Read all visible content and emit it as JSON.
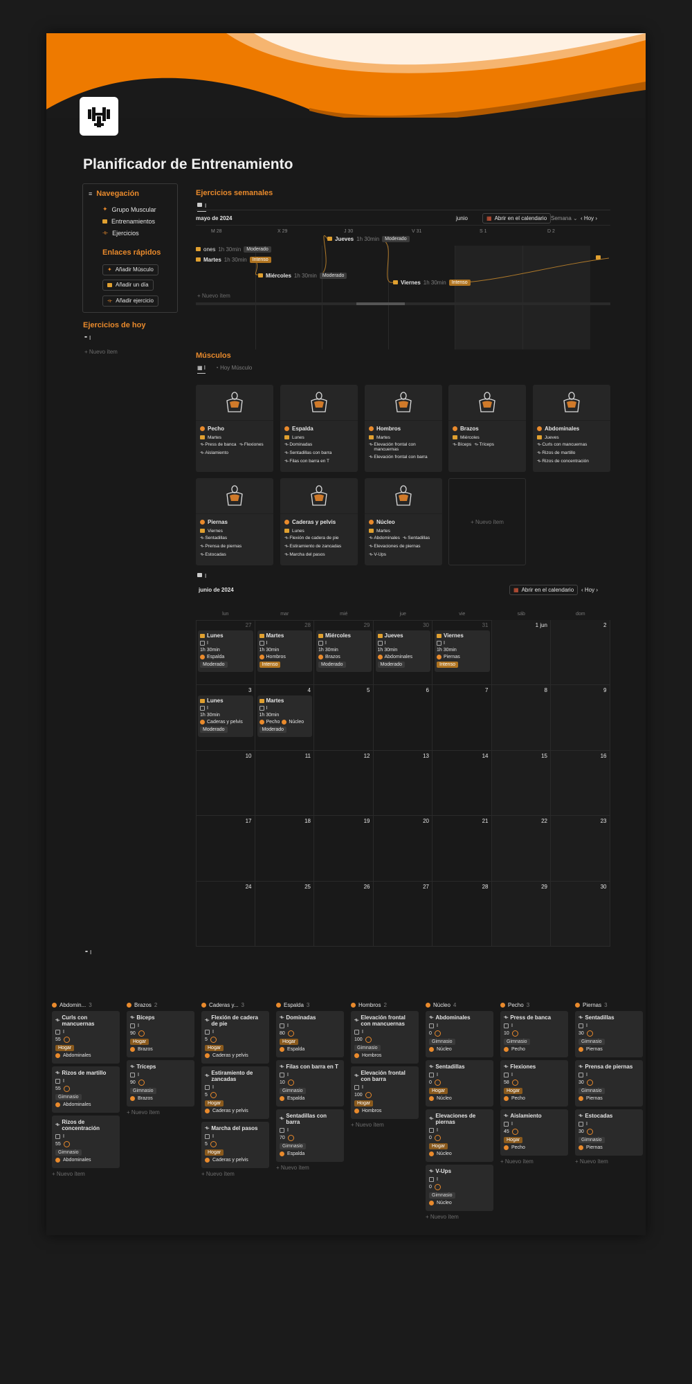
{
  "page": {
    "title": "Planificador de Entrenamiento",
    "colors": {
      "accent": "#e98a2c",
      "background": "#191919",
      "card": "#262626"
    }
  },
  "nav": {
    "heading": "Navegación",
    "items": [
      "Grupo Muscular",
      "Entrenamientos",
      "Ejercicios"
    ],
    "quick_heading": "Enlaces rápidos",
    "quick": [
      "Añadir Músculo",
      "Añadir un día",
      "Añadir ejercicio"
    ]
  },
  "today": {
    "heading": "Ejercicios de hoy",
    "view": "I",
    "new": "+ Nuevo ítem"
  },
  "weekly": {
    "heading": "Ejercicios semanales",
    "view": "I",
    "month": "mayo de 2024",
    "month2": "junio",
    "open_cal": "Abrir en el calendario",
    "scale": "Semana",
    "today": "Hoy",
    "days": [
      "M 28",
      "X 29",
      "J 30",
      "V 31",
      "S 1",
      "D 2"
    ],
    "items": [
      {
        "name": "ones",
        "dur": "1h 30min",
        "tag": "Moderado"
      },
      {
        "name": "Martes",
        "dur": "1h 30min",
        "tag": "Intenso"
      },
      {
        "name": "Jueves",
        "dur": "1h 30min",
        "tag": "Moderado"
      },
      {
        "name": "Miércoles",
        "dur": "1h 30min",
        "tag": "Moderado"
      },
      {
        "name": "Viernes",
        "dur": "1h 30min",
        "tag": "Intenso"
      }
    ],
    "new": "+ Nuevo ítem"
  },
  "muscles": {
    "heading": "Músculos",
    "views": [
      "I",
      "Hoy Músculo"
    ],
    "cards": [
      {
        "name": "Pecho",
        "day": "Martes",
        "ex": [
          "Press de banca",
          "Flexiones",
          "Aislamiento"
        ]
      },
      {
        "name": "Espalda",
        "day": "Lunes",
        "ex": [
          "Dominadas",
          "Sentadillas con barra",
          "Filas con barra en T"
        ]
      },
      {
        "name": "Hombros",
        "day": "Martes",
        "ex": [
          "Elevación frontal con mancuernas",
          "Elevación frontal con barra"
        ]
      },
      {
        "name": "Brazos",
        "day": "Miércoles",
        "ex": [
          "Bíceps",
          "Tríceps"
        ]
      },
      {
        "name": "Abdominales",
        "day": "Jueves",
        "ex": [
          "Curls con mancuernas",
          "Rizos de martillo",
          "Rizos de concentración"
        ]
      },
      {
        "name": "Piernas",
        "day": "Viernes",
        "ex": [
          "Sentadillas",
          "Prensa de piernas",
          "Estocadas"
        ]
      },
      {
        "name": "Caderas y pelvis",
        "day": "Lunes",
        "ex": [
          "Flexión de cadera de pie",
          "Estiramiento de zancadas",
          "Marcha del pasos"
        ]
      },
      {
        "name": "Núcleo",
        "day": "Martes",
        "ex": [
          "Abdominales",
          "Sentadillas",
          "Elevaciones de piernas",
          "V-Ups"
        ]
      }
    ],
    "new": "+ Nuevo ítem"
  },
  "calendar": {
    "view": "I",
    "month": "junio de 2024",
    "open_cal": "Abrir en el calendario",
    "today": "Hoy",
    "weekdays": [
      "lun",
      "mar",
      "mié",
      "jue",
      "vie",
      "sáb",
      "dom"
    ],
    "weeks": [
      [
        "27",
        "28",
        "29",
        "30",
        "31",
        "1 jun",
        "2"
      ],
      [
        "3",
        "4",
        "5",
        "6",
        "7",
        "8",
        "9"
      ],
      [
        "10",
        "11",
        "12",
        "13",
        "14",
        "15",
        "16"
      ],
      [
        "17",
        "18",
        "19",
        "20",
        "21",
        "22",
        "23"
      ],
      [
        "24",
        "25",
        "26",
        "27",
        "28",
        "29",
        "30"
      ]
    ],
    "events": [
      {
        "week": 0,
        "day": 0,
        "name": "Lunes",
        "check": "I",
        "dur": "1h 30min",
        "muscles": [
          "Espalda"
        ],
        "tag": "Moderado"
      },
      {
        "week": 0,
        "day": 1,
        "name": "Martes",
        "check": "I",
        "dur": "1h 30min",
        "muscles": [
          "Hombros"
        ],
        "tag": "Intenso"
      },
      {
        "week": 0,
        "day": 2,
        "name": "Miércoles",
        "check": "I",
        "dur": "1h 30min",
        "muscles": [
          "Brazos"
        ],
        "tag": "Moderado"
      },
      {
        "week": 0,
        "day": 3,
        "name": "Jueves",
        "check": "I",
        "dur": "1h 30min",
        "muscles": [
          "Abdominales"
        ],
        "tag": "Moderado"
      },
      {
        "week": 0,
        "day": 4,
        "name": "Viernes",
        "check": "I",
        "dur": "1h 30min",
        "muscles": [
          "Piernas"
        ],
        "tag": "Intenso"
      },
      {
        "week": 1,
        "day": 0,
        "name": "Lunes",
        "check": "I",
        "dur": "1h 30min",
        "muscles": [
          "Caderas y pelvis"
        ],
        "tag": "Moderado"
      },
      {
        "week": 1,
        "day": 1,
        "name": "Martes",
        "check": "I",
        "dur": "1h 30min",
        "muscles": [
          "Pecho",
          "Núcleo"
        ],
        "tag": "Moderado"
      }
    ]
  },
  "board": {
    "view": "I",
    "new": "+ Nuevo ítem",
    "columns": [
      {
        "name": "Abdomin...",
        "count": "3",
        "cards": [
          {
            "name": "Curls con mancuernas",
            "check": "I",
            "val": "55",
            "place": "Hogar",
            "muscle": "Abdominales"
          },
          {
            "name": "Rizos de martillo",
            "check": "I",
            "val": "55",
            "place": "Gimnasio",
            "muscle": "Abdominales"
          },
          {
            "name": "Rizos de concentración",
            "check": "I",
            "val": "55",
            "place": "Gimnasio",
            "muscle": "Abdominales"
          }
        ]
      },
      {
        "name": "Brazos",
        "count": "2",
        "cards": [
          {
            "name": "Bíceps",
            "check": "I",
            "val": "90",
            "place": "Hogar",
            "muscle": "Brazos"
          },
          {
            "name": "Tríceps",
            "check": "I",
            "val": "90",
            "place": "Gimnasio",
            "muscle": "Brazos"
          }
        ]
      },
      {
        "name": "Caderas y...",
        "count": "3",
        "cards": [
          {
            "name": "Flexión de cadera de pie",
            "check": "I",
            "val": "5",
            "place": "Hogar",
            "muscle": "Caderas y pelvis"
          },
          {
            "name": "Estiramiento de zancadas",
            "check": "I",
            "val": "5",
            "place": "Hogar",
            "muscle": "Caderas y pelvis"
          },
          {
            "name": "Marcha del pasos",
            "check": "I",
            "val": "5",
            "place": "Hogar",
            "muscle": "Caderas y pelvis"
          }
        ]
      },
      {
        "name": "Espalda",
        "count": "3",
        "cards": [
          {
            "name": "Dominadas",
            "check": "I",
            "val": "80",
            "place": "Hogar",
            "muscle": "Espalda"
          },
          {
            "name": "Filas con barra en T",
            "check": "I",
            "val": "10",
            "place": "Gimnasio",
            "muscle": "Espalda"
          },
          {
            "name": "Sentadillas con barra",
            "check": "I",
            "val": "70",
            "place": "Gimnasio",
            "muscle": "Espalda"
          }
        ]
      },
      {
        "name": "Hombros",
        "count": "2",
        "cards": [
          {
            "name": "Elevación frontal con mancuernas",
            "check": "I",
            "val": "100",
            "place": "Gimnasio",
            "muscle": "Hombros"
          },
          {
            "name": "Elevación frontal con barra",
            "check": "I",
            "val": "100",
            "place": "Hogar",
            "muscle": "Hombros"
          }
        ]
      },
      {
        "name": "Núcleo",
        "count": "4",
        "cards": [
          {
            "name": "Abdominales",
            "check": "I",
            "val": "0",
            "place": "Gimnasio",
            "muscle": "Núcleo"
          },
          {
            "name": "Sentadillas",
            "check": "I",
            "val": "0",
            "place": "Hogar",
            "muscle": "Núcleo"
          },
          {
            "name": "Elevaciones de piernas",
            "check": "I",
            "val": "0",
            "place": "Hogar",
            "muscle": "Núcleo"
          },
          {
            "name": "V-Ups",
            "check": "I",
            "val": "0",
            "place": "Gimnasio",
            "muscle": "Núcleo"
          }
        ]
      },
      {
        "name": "Pecho",
        "count": "3",
        "cards": [
          {
            "name": "Press de banca",
            "check": "I",
            "val": "10",
            "place": "Gimnasio",
            "muscle": "Pecho"
          },
          {
            "name": "Flexiones",
            "check": "I",
            "val": "58",
            "place": "Hogar",
            "muscle": "Pecho"
          },
          {
            "name": "Aislamiento",
            "check": "I",
            "val": "45",
            "place": "Hogar",
            "muscle": "Pecho"
          }
        ]
      },
      {
        "name": "Piernas",
        "count": "3",
        "cards": [
          {
            "name": "Sentadillas",
            "check": "I",
            "val": "30",
            "place": "Gimnasio",
            "muscle": "Piernas"
          },
          {
            "name": "Prensa de piernas",
            "check": "I",
            "val": "30",
            "place": "Gimnasio",
            "muscle": "Piernas"
          },
          {
            "name": "Estocadas",
            "check": "I",
            "val": "30",
            "place": "Gimnasio",
            "muscle": "Piernas"
          }
        ]
      }
    ]
  }
}
